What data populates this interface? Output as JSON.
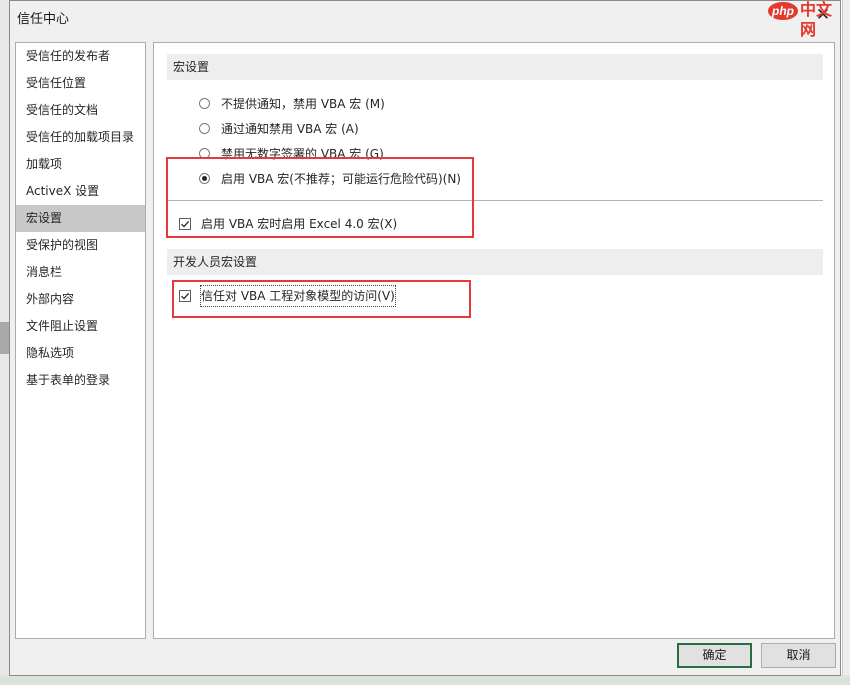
{
  "window": {
    "title": "信任中心"
  },
  "watermark": {
    "logo": "php",
    "text": "中文网"
  },
  "sidebar": {
    "items": [
      {
        "label": "受信任的发布者"
      },
      {
        "label": "受信任位置"
      },
      {
        "label": "受信任的文档"
      },
      {
        "label": "受信任的加载项目录"
      },
      {
        "label": "加载项"
      },
      {
        "label": "ActiveX 设置"
      },
      {
        "label": "宏设置",
        "selected": true
      },
      {
        "label": "受保护的视图"
      },
      {
        "label": "消息栏"
      },
      {
        "label": "外部内容"
      },
      {
        "label": "文件阻止设置"
      },
      {
        "label": "隐私选项"
      },
      {
        "label": "基于表单的登录"
      }
    ]
  },
  "macro_settings": {
    "header": "宏设置",
    "options": [
      {
        "label": "不提供通知，禁用 VBA 宏 (M)",
        "checked": false
      },
      {
        "label": "通过通知禁用 VBA 宏 (A)",
        "checked": false
      },
      {
        "label": "禁用无数字签署的 VBA 宏 (G)",
        "checked": false
      },
      {
        "label": "启用 VBA 宏(不推荐；可能运行危险代码)(N)",
        "checked": true
      }
    ],
    "excel4_checkbox": {
      "label": "启用 VBA 宏时启用 Excel 4.0 宏(X)",
      "checked": true
    }
  },
  "developer_settings": {
    "header": "开发人员宏设置",
    "trust_vba_checkbox": {
      "label": "信任对 VBA 工程对象模型的访问(V)",
      "checked": true
    }
  },
  "buttons": {
    "ok": "确定",
    "cancel": "取消"
  },
  "colors": {
    "highlight": "#e8393a",
    "selected_nav": "#c8c8c8",
    "default_button_border": "#2a6e3f"
  },
  "icons": {
    "close": "close-icon",
    "check": "check-icon"
  }
}
